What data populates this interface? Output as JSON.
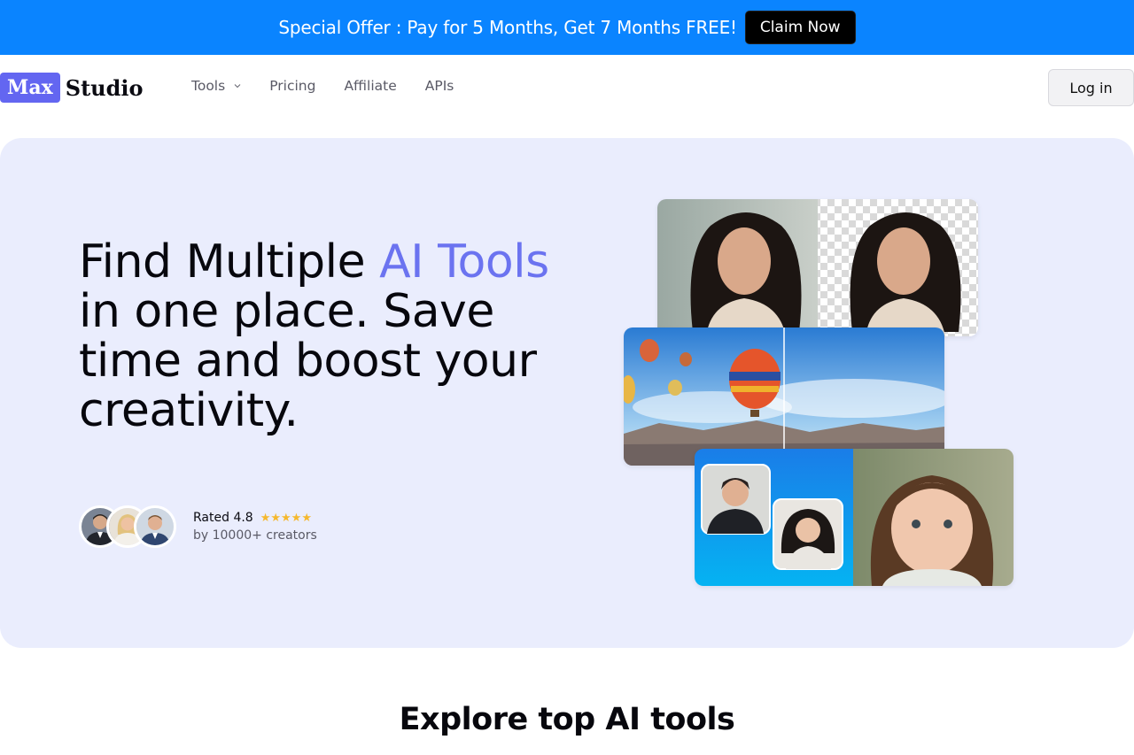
{
  "promo": {
    "text": "Special Offer : Pay for 5 Months, Get 7 Months FREE!",
    "button_label": "Claim Now"
  },
  "nav": {
    "logo_box": "Max",
    "logo_word": "Studio",
    "links": [
      {
        "label": "Tools",
        "has_dropdown": true
      },
      {
        "label": "Pricing"
      },
      {
        "label": "Affiliate"
      },
      {
        "label": "APIs"
      }
    ],
    "login_label": "Log in"
  },
  "hero": {
    "headline": {
      "part1": "Find Multiple ",
      "accent": "AI Tools",
      "part2": " in one place. Save time and boost your creativity."
    },
    "rating": {
      "label": "Rated 4.8",
      "stars": "★★★★★",
      "sub": "by 10000+ creators"
    }
  },
  "explore": {
    "title": "Explore top AI tools"
  },
  "colors": {
    "banner": "#0a84ff",
    "accent": "#6b73f0",
    "logo": "#6366f1",
    "hero_bg": "#eaedfd"
  }
}
